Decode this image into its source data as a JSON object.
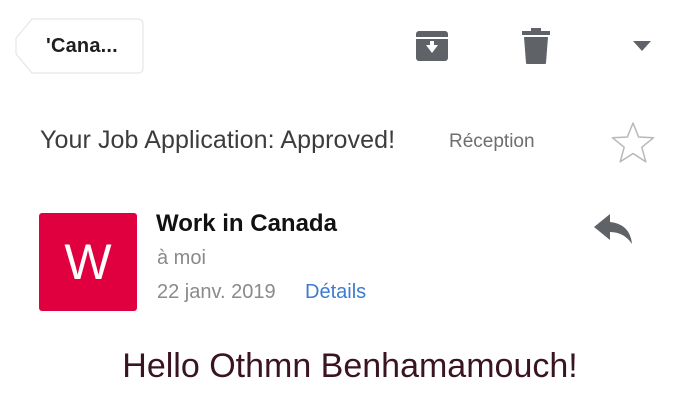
{
  "toolbar": {
    "back_label": "'Cana...",
    "icons": [
      "archive-icon",
      "trash-icon",
      "dropdown-arrow-icon"
    ]
  },
  "email": {
    "subject": "Your Job Application: Approved!",
    "label": "Réception",
    "sender": {
      "name": "Work in Canada",
      "avatar_letter": "W",
      "avatar_color": "#e0003f"
    },
    "recipient": "à moi",
    "date": "22 janv. 2019",
    "details_link": "Détails",
    "body_greeting": "Hello Othmn Benhamamouch!"
  },
  "colors": {
    "icon_gray": "#5f6368",
    "link_blue": "#3c7bd0",
    "greeting_color": "#3a1520"
  }
}
